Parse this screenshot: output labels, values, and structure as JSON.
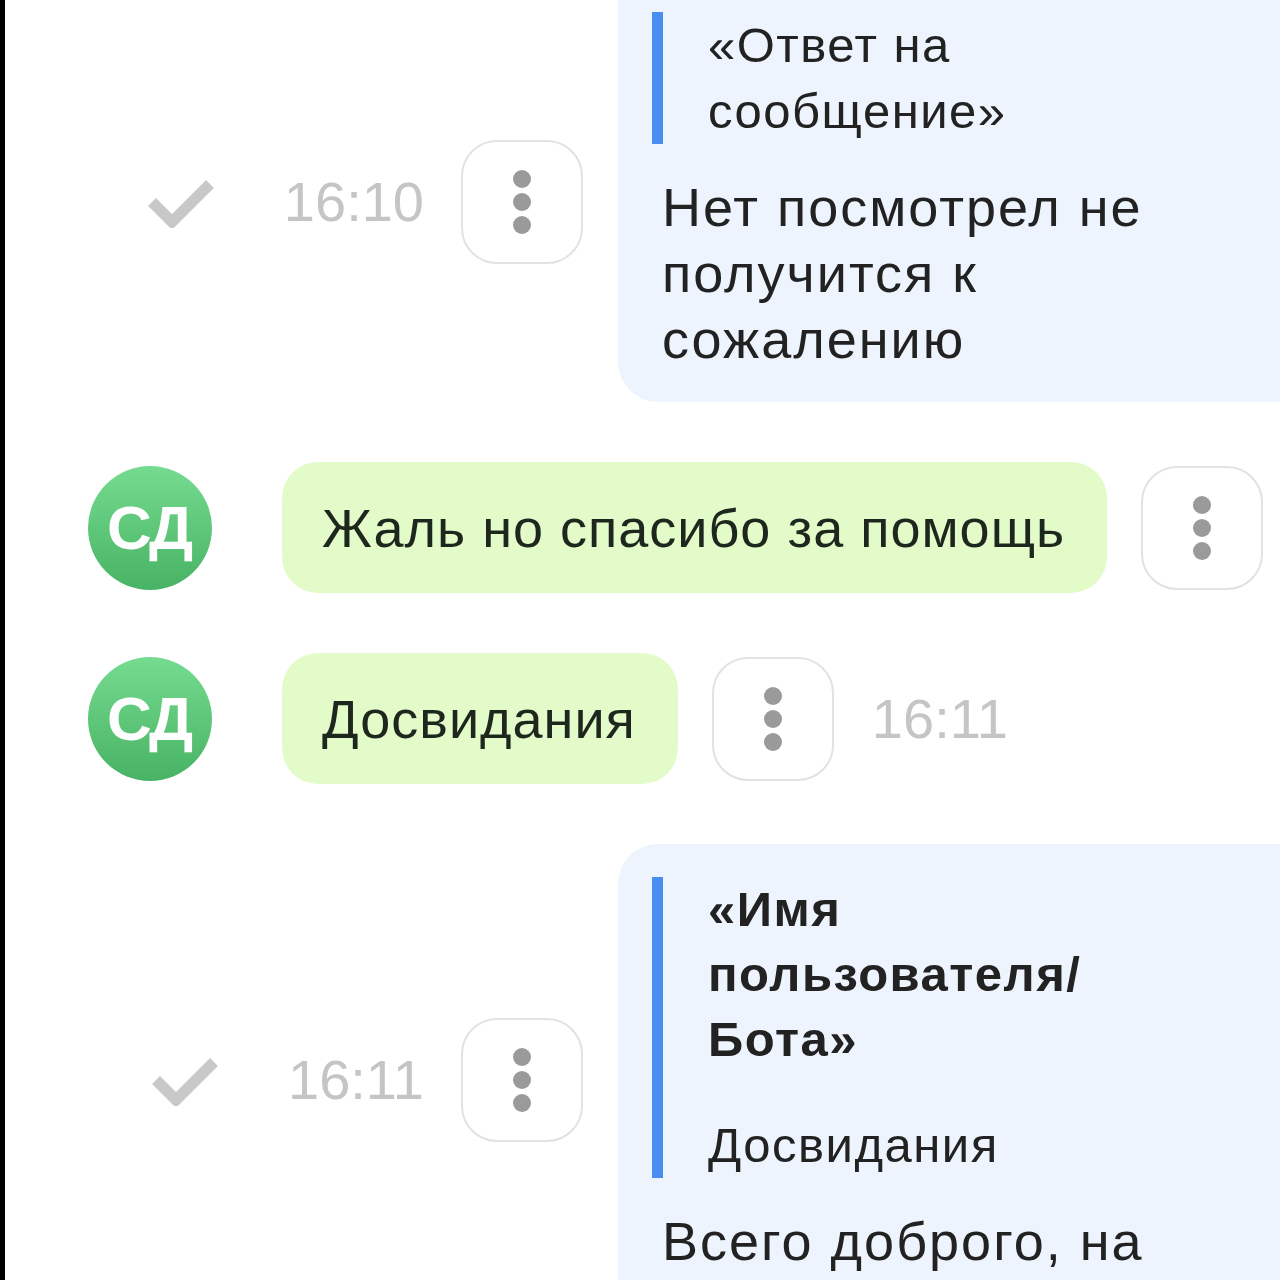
{
  "messages": [
    {
      "kind": "outgoing",
      "delivered": true,
      "time": "16:10",
      "reply": {
        "text": "«Ответ на сообщение»"
      },
      "text": "Нет посмотрел не получится к сожалению"
    },
    {
      "kind": "incoming",
      "initials": "СД",
      "text": "Жаль но спасибо за помощь"
    },
    {
      "kind": "incoming",
      "initials": "СД",
      "text": "Досвидания",
      "time": "16:11"
    },
    {
      "kind": "outgoing",
      "delivered": true,
      "time": "16:11",
      "reply": {
        "author": "«Имя пользователя/Бота»",
        "text": "Досвидания"
      },
      "text": "Всего доброго, на"
    }
  ]
}
